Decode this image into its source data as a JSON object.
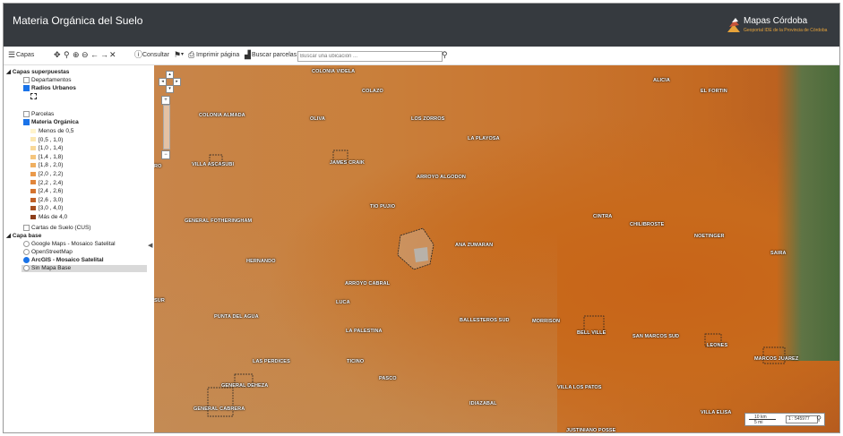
{
  "header": {
    "title": "Materia Orgánica del Suelo",
    "logo_name": "Mapas Córdoba",
    "logo_sub": "Geoportal IDE de la Provincia de Córdoba"
  },
  "toolbar": {
    "layers": "Capas",
    "consult": "Consultar",
    "print": "Imprimir página",
    "parcels": "Buscar parcelas",
    "search_placeholder": "Buscar una ubicación ..."
  },
  "sidebar": {
    "overlay_title": "Capas superpuestas",
    "overlays": [
      {
        "label": "Departamentos",
        "checked": false
      },
      {
        "label": "Radios Urbanos",
        "checked": true
      },
      {
        "label": "Parcelas",
        "checked": false
      },
      {
        "label": "Materia Orgánica",
        "checked": true
      }
    ],
    "legend": [
      {
        "label": "Menos de 0,5",
        "color": "#fff4cc"
      },
      {
        "label": "[0,5 , 1,0)",
        "color": "#fbe7b0"
      },
      {
        "label": "[1,0 , 1,4)",
        "color": "#f8d898"
      },
      {
        "label": "[1,4 , 1,8)",
        "color": "#f5c57c"
      },
      {
        "label": "[1,8 , 2,0)",
        "color": "#f0b061"
      },
      {
        "label": "[2,0 , 2,2)",
        "color": "#ea9a4b"
      },
      {
        "label": "[2,2 , 2,4)",
        "color": "#e1853a"
      },
      {
        "label": "[2,4 , 2,6)",
        "color": "#d4732f"
      },
      {
        "label": "[2,6 , 3,0)",
        "color": "#c16128"
      },
      {
        "label": "[3,0 , 4,0)",
        "color": "#a85021"
      },
      {
        "label": "Más de 4,0",
        "color": "#8c3e1a"
      }
    ],
    "soil_maps": "Cartas de Suelo (CUS)",
    "base_title": "Capa base",
    "bases": [
      {
        "label": "Google Maps - Mosaico Satelital",
        "selected": false
      },
      {
        "label": "OpenStreetMap",
        "selected": false
      },
      {
        "label": "ArcGIS - Mosaico Satelital",
        "selected": true
      },
      {
        "label": "Sin Mapa Base",
        "selected": false
      }
    ]
  },
  "map": {
    "towns": [
      "COLONIA VIDELA",
      "COLAZO",
      "ALICIA",
      "EL FORTIN",
      "COLONIA ALMADA",
      "OLIVA",
      "LOS ZORROS",
      "LA PLAYOSA",
      "RO",
      "VILLA ASCASUBI",
      "JAMES CRAIK",
      "ARROYO ALGODON",
      "TIO PUJIO",
      "GENERAL FOTHERINGHAM",
      "CINTRA",
      "CHILIBROSTE",
      "NOETINGER",
      "SAIRA",
      "ANA ZUMARAN",
      "HERNANDO",
      "ARROYO CABRAL",
      "SUR",
      "LUCA",
      "PUNTA DEL AGUA",
      "BALLESTEROS SUD",
      "MORRISON",
      "BELL VILLE",
      "SAN MARCOS SUD",
      "LA PALESTINA",
      "LEONES",
      "LAS PERDICES",
      "TICINO",
      "MARCOS JUAREZ",
      "GENERAL DEHEZA",
      "PASCO",
      "VILLA LOS PATOS",
      "GENERAL CABRERA",
      "IDIAZABAL",
      "VILLA ELISA",
      "JUSTINIANO POSSE"
    ],
    "scale_bar_top": "10 km",
    "scale_bar_bottom": "5 mi",
    "scale_value": "1 : 545977"
  },
  "colors": {
    "header_bg": "#363a3f",
    "accent": "#1a73e8",
    "logo_orange": "#e7a33a"
  }
}
